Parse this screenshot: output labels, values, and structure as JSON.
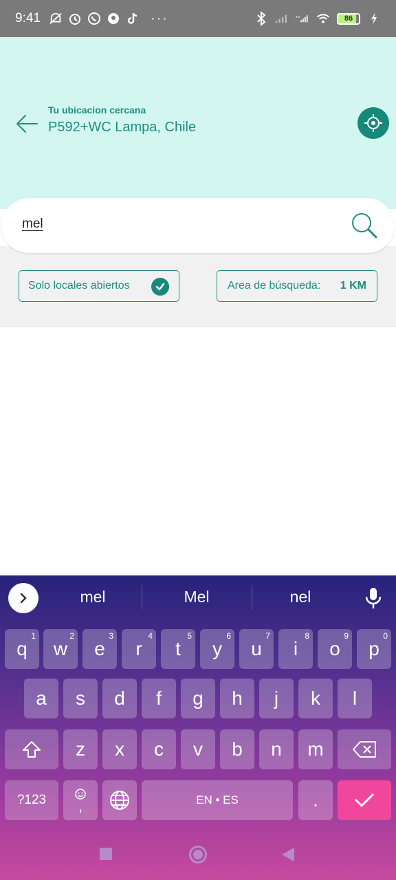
{
  "status_bar": {
    "time": "9:41",
    "dots": "···",
    "battery": "86",
    "left_icons": [
      "do-not-disturb-icon",
      "alarm-icon",
      "whatsapp-icon",
      "app-icon",
      "tiktok-icon"
    ],
    "right_icons": [
      "bluetooth-icon",
      "signal-off-icon",
      "4g-signal-icon",
      "wifi-icon",
      "battery-icon",
      "charging-icon"
    ]
  },
  "header": {
    "caption": "Tu ubicacion cercana",
    "address": "P592+WC Lampa, Chile",
    "background": "#d4f6f1",
    "accent": "#17897a"
  },
  "search": {
    "value": "mel"
  },
  "filters": {
    "open_label": "Solo locales abiertos",
    "area_label": "Area de búsqueda:",
    "area_value": "1 KM"
  },
  "keyboard": {
    "suggestions": [
      "mel",
      "Mel",
      "nel"
    ],
    "row1": [
      {
        "key": "q",
        "num": "1"
      },
      {
        "key": "w",
        "num": "2"
      },
      {
        "key": "e",
        "num": "3"
      },
      {
        "key": "r",
        "num": "4"
      },
      {
        "key": "t",
        "num": "5"
      },
      {
        "key": "y",
        "num": "6"
      },
      {
        "key": "u",
        "num": "7"
      },
      {
        "key": "i",
        "num": "8"
      },
      {
        "key": "o",
        "num": "9"
      },
      {
        "key": "p",
        "num": "0"
      }
    ],
    "row2": [
      "a",
      "s",
      "d",
      "f",
      "g",
      "h",
      "j",
      "k",
      "l"
    ],
    "row3": [
      "z",
      "x",
      "c",
      "v",
      "b",
      "n",
      "m"
    ],
    "symbols_label": "?123",
    "emoji_comma": ",",
    "space_label": "EN • ES",
    "period": "."
  }
}
